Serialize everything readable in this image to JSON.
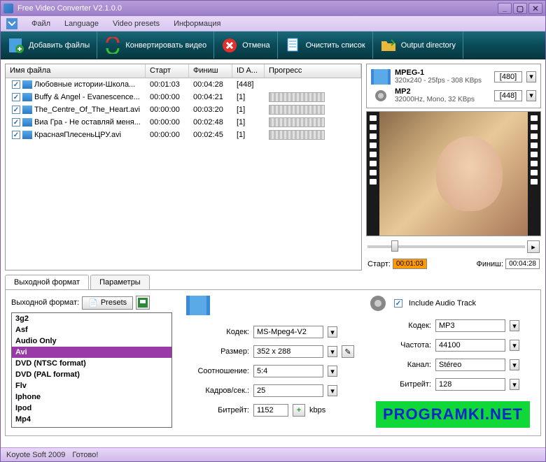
{
  "window": {
    "title": "Free Video Converter V2.1.0.0"
  },
  "menubar": [
    "Файл",
    "Language",
    "Video presets",
    "Информация"
  ],
  "toolbar": {
    "add": "Добавить файлы",
    "convert": "Конвертировать видео",
    "cancel": "Отмена",
    "clear": "Очистить список",
    "outdir": "Output directory"
  },
  "columns": {
    "name": "Имя файла",
    "start": "Старт",
    "finish": "Финиш",
    "id": "ID A...",
    "progress": "Прогресс"
  },
  "files": [
    {
      "name": "Любовные истории-Школа...",
      "start": "00:01:03",
      "finish": "00:04:28",
      "id": "[448]",
      "progress": false
    },
    {
      "name": "Buffy & Angel - Evanescence...",
      "start": "00:00:00",
      "finish": "00:04:21",
      "id": "[1]",
      "progress": true
    },
    {
      "name": "The_Centre_Of_The_Heart.avi",
      "start": "00:00:00",
      "finish": "00:03:20",
      "id": "[1]",
      "progress": true
    },
    {
      "name": "Виа Гра - Не оставляй меня...",
      "start": "00:00:00",
      "finish": "00:02:48",
      "id": "[1]",
      "progress": true
    },
    {
      "name": "КраснаяПлесеньЦРУ.avi",
      "start": "00:00:00",
      "finish": "00:02:45",
      "id": "[1]",
      "progress": true
    }
  ],
  "video_fmt": {
    "name": "MPEG-1",
    "detail": "320x240 - 25fps - 308 KBps",
    "sel": "[480]"
  },
  "audio_fmt": {
    "name": "MP2",
    "detail": "32000Hz, Mono, 32 KBps",
    "sel": "[448]"
  },
  "playback": {
    "start_lbl": "Старт:",
    "start_val": "00:01:03",
    "finish_lbl": "Финиш:",
    "finish_val": "00:04:28"
  },
  "tabs": {
    "t1": "Выходной формат",
    "t2": "Параметры"
  },
  "out": {
    "label": "Выходной формат:",
    "presets": "Presets",
    "list": [
      "3g2",
      "Asf",
      "Audio Only",
      "Avi",
      "DVD (NTSC format)",
      "DVD (PAL format)",
      "Flv",
      "Iphone",
      "Ipod",
      "Mp4"
    ],
    "selected": "Avi"
  },
  "video_enc": {
    "codec_lbl": "Кодек:",
    "codec": "MS-Mpeg4-V2",
    "size_lbl": "Размер:",
    "size": "352 x 288",
    "ratio_lbl": "Соотношение:",
    "ratio": "5:4",
    "fps_lbl": "Кадров/сек.:",
    "fps": "25",
    "bitrate_lbl": "Битрейт:",
    "bitrate": "1152",
    "bitrate_unit": "kbps"
  },
  "audio_enc": {
    "include": "Include Audio Track",
    "codec_lbl": "Кодек:",
    "codec": "MP3",
    "freq_lbl": "Частота:",
    "freq": "44100",
    "channel_lbl": "Канал:",
    "channel": "Stéreo",
    "bitrate_lbl": "Битрейт:",
    "bitrate": "128"
  },
  "status": {
    "company": "Koyote Soft 2009",
    "text": "Готово!"
  },
  "watermark": "PROGRAMKI.NET"
}
